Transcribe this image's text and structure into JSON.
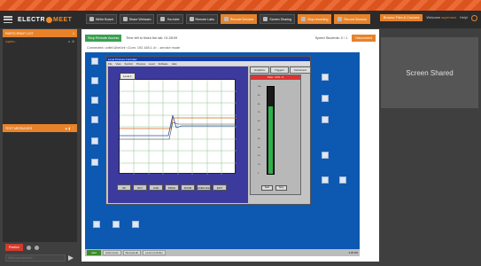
{
  "app": {
    "logo_left": "ELECTR",
    "logo_right": "MEET"
  },
  "toolbar": {
    "tools": [
      {
        "label": "White Board",
        "icon": "whiteboard-icon",
        "orange": false
      },
      {
        "label": "Share Webcam",
        "icon": "webcam-icon",
        "orange": false
      },
      {
        "label": "You tube",
        "icon": "youtube-icon",
        "orange": false
      },
      {
        "label": "Remote Labs",
        "icon": "remote-labs-icon",
        "orange": false
      },
      {
        "label": "Remote Devices",
        "icon": "remote-devices-icon",
        "orange": true
      },
      {
        "label": "Screen Sharing",
        "icon": "screen-share-icon",
        "orange": false
      },
      {
        "label": "Stop recording",
        "icon": "record-icon",
        "orange": true
      },
      {
        "label": "Record Session",
        "icon": "record-session-icon",
        "orange": true
      }
    ],
    "browse_label": "Browse Files & Courses",
    "welcome_prefix": "Welcome",
    "welcome_user": "superuser",
    "help_label": "Help!"
  },
  "sidebar": {
    "participants_header": "PARTICIPANT LIST",
    "participants_count": "1",
    "participant_name": "superu...",
    "chat_header": "TEXT MESSAGES",
    "publish_label": "Publish",
    "message_placeholder": "Write your text here"
  },
  "session": {
    "stop_label": "Stop Remote Access",
    "time_left": "Time left to finish the lab: 01:28:09",
    "speed": "Speed Students: 0 / 1",
    "disconnect_label": "Disconnect",
    "connection": "Connected: unifel.Ubel.int <Com: 192.168.1.4> - service mode"
  },
  "desktop": {
    "window_title": "Level Process Controller",
    "menu": [
      "File",
      "View",
      "Symbol",
      "Process",
      "Level",
      "Software",
      "Help"
    ],
    "plot_tab": "Level 1",
    "right_tabs": [
      "Graphics",
      "Triggers",
      "Instrument"
    ],
    "gauge_title": "Flow : 17% - 0",
    "gauge_level": 0.78,
    "gauge_scale": [
      "100",
      "90",
      "80",
      "70",
      "60",
      "50",
      "40",
      "30",
      "20",
      "10",
      "0"
    ],
    "gauge_buttons": [
      "Start",
      "Stop"
    ],
    "bottom_buttons": [
      "SP",
      "OUT",
      "LOW",
      "PROG",
      "ZOOM",
      "LINES Run",
      "EXIT"
    ],
    "start_label": "start",
    "taskbar_items": [
      "Instruments",
      "RemoteLab",
      "Level Controller"
    ],
    "clock": "3:38 PM"
  },
  "right_panel": {
    "label": "Screen Shared"
  }
}
